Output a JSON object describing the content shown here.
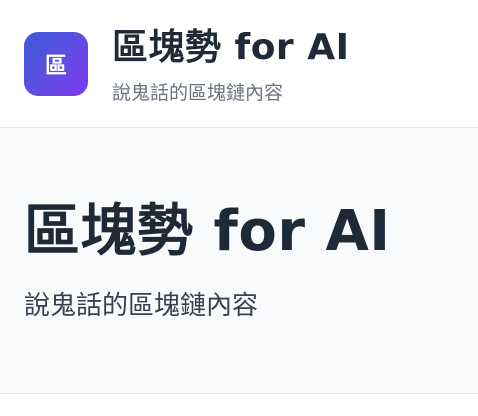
{
  "header": {
    "logo_glyph": "區",
    "title": "區塊勢 for AI",
    "subtitle": "說鬼話的區塊鏈內容"
  },
  "hero": {
    "title": "區塊勢 for AI",
    "subtitle": "說鬼話的區塊鏈內容"
  },
  "colors": {
    "logo_gradient_start": "#3b5bdb",
    "logo_gradient_end": "#7c3aed",
    "text_primary": "#1f2937",
    "text_secondary": "#6b7280",
    "hero_background": "#f9fafb"
  }
}
